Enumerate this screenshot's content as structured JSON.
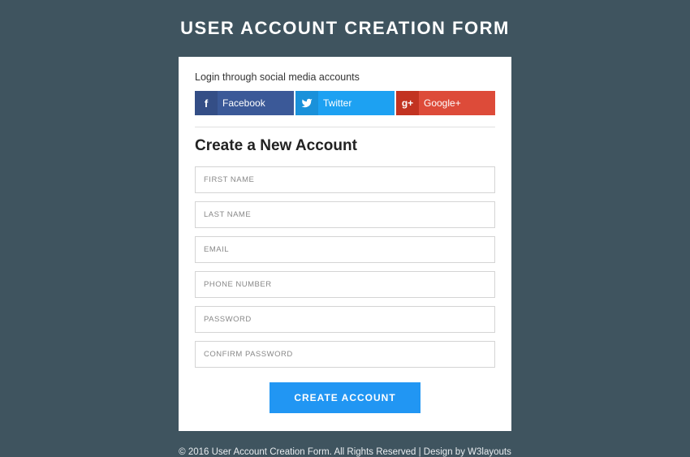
{
  "page_title": "USER ACCOUNT CREATION FORM",
  "card": {
    "social_label": "Login through social media accounts",
    "social": {
      "facebook": {
        "label": "Facebook",
        "icon": "f"
      },
      "twitter": {
        "label": "Twitter",
        "icon": "t"
      },
      "google": {
        "label": "Google+",
        "icon": "g+"
      }
    },
    "form_title": "Create a New Account",
    "fields": {
      "first_name": "FIRST NAME",
      "last_name": "LAST NAME",
      "email": "EMAIL",
      "phone": "PHONE NUMBER",
      "password": "PASSWORD",
      "confirm_password": "CONFIRM PASSWORD"
    },
    "submit_label": "CREATE ACCOUNT"
  },
  "footer": {
    "text_prefix": "© 2016 User Account Creation Form. All Rights Reserved | Design by ",
    "link_text": "W3layouts"
  }
}
